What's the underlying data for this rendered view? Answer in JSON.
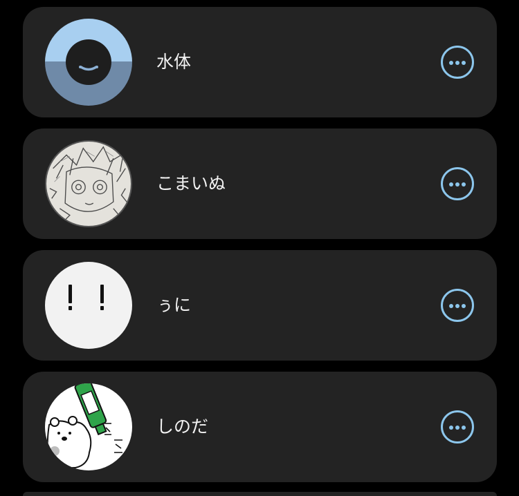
{
  "colors": {
    "background": "#000000",
    "card": "#232323",
    "text": "#f2f2f2",
    "accent": "#8cc6ec"
  },
  "list": {
    "items": [
      {
        "name": "水体",
        "avatar": "smiley-face-avatar",
        "action_icon": "more-options-icon"
      },
      {
        "name": "こまいぬ",
        "avatar": "sketch-character-avatar",
        "action_icon": "more-options-icon"
      },
      {
        "name": "ぅに",
        "avatar": "exclamation-face-avatar",
        "action_icon": "more-options-icon"
      },
      {
        "name": "しのだ",
        "avatar": "bear-with-bottle-avatar",
        "action_icon": "more-options-icon"
      }
    ]
  }
}
